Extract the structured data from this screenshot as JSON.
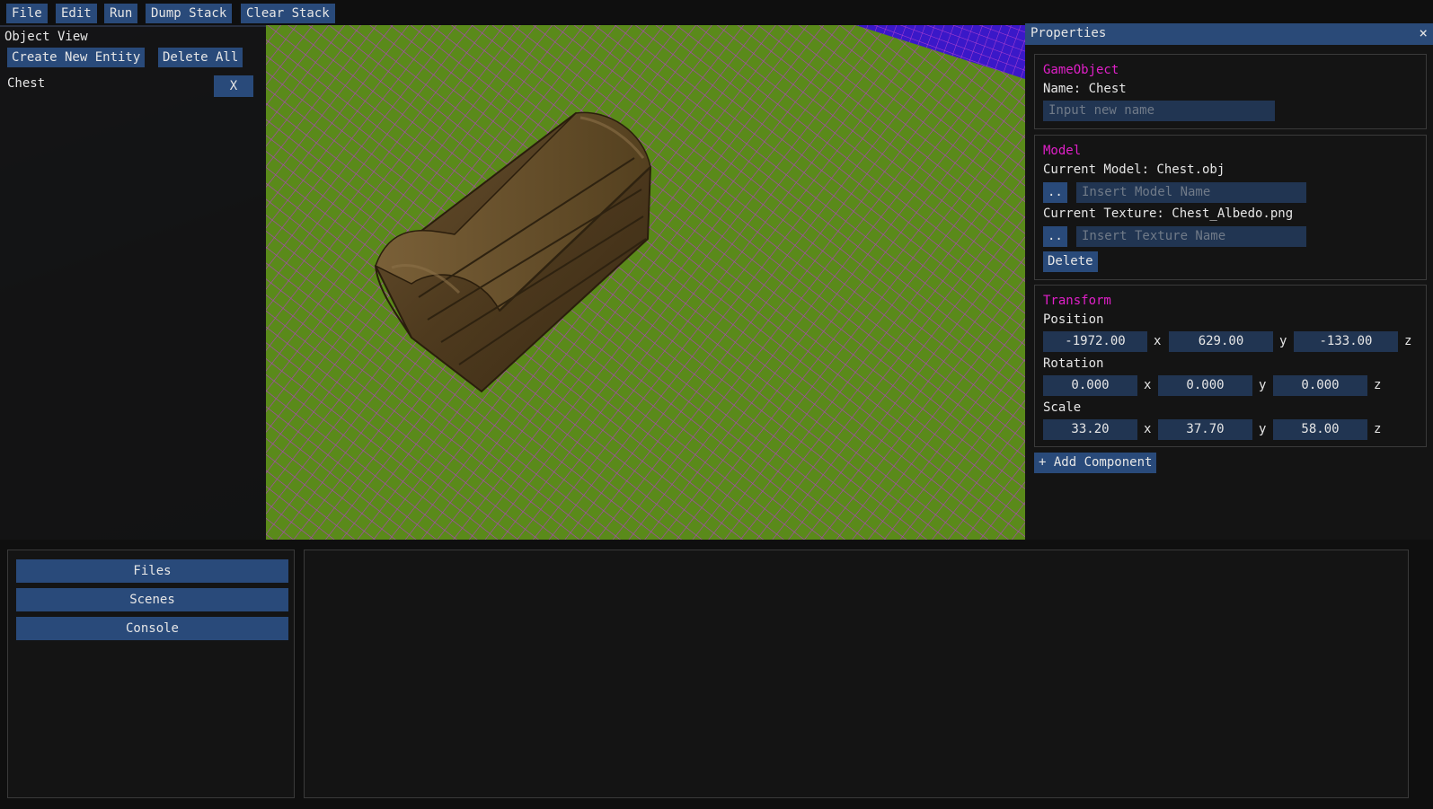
{
  "menubar": {
    "items": [
      "File",
      "Edit",
      "Run",
      "Dump Stack",
      "Clear Stack"
    ]
  },
  "object_view": {
    "title": "Object View",
    "create_label": "Create New Entity",
    "delete_all_label": "Delete All",
    "entities": [
      {
        "name": "Chest",
        "remove_label": "X"
      }
    ]
  },
  "properties": {
    "title": "Properties",
    "close_label": "×",
    "gameobject": {
      "heading": "GameObject",
      "name_text": "Name: Chest",
      "name_placeholder": "Input new name"
    },
    "model": {
      "heading": "Model",
      "current_model": "Current Model: Chest.obj",
      "browse_label": "..",
      "model_placeholder": "Insert Model Name",
      "current_texture": "Current Texture: Chest_Albedo.png",
      "texture_placeholder": "Insert Texture Name",
      "delete_label": "Delete"
    },
    "transform": {
      "heading": "Transform",
      "position_label": "Position",
      "position": [
        "-1972.00",
        "629.00",
        "-133.00"
      ],
      "rotation_label": "Rotation",
      "rotation": [
        "0.000",
        "0.000",
        "0.000"
      ],
      "scale_label": "Scale",
      "scale": [
        "33.20",
        "37.70",
        "58.00"
      ],
      "axes": [
        "x",
        "y",
        "z"
      ]
    },
    "add_component_label": "+ Add Component"
  },
  "bottom": {
    "tabs": [
      "Files",
      "Scenes",
      "Console"
    ]
  },
  "colors": {
    "accent": "#294a7a",
    "section_heading": "#e020c8",
    "ground": "#5a8a1a",
    "grid_line": "#b040c0",
    "chest_wood": "#5a4322"
  }
}
